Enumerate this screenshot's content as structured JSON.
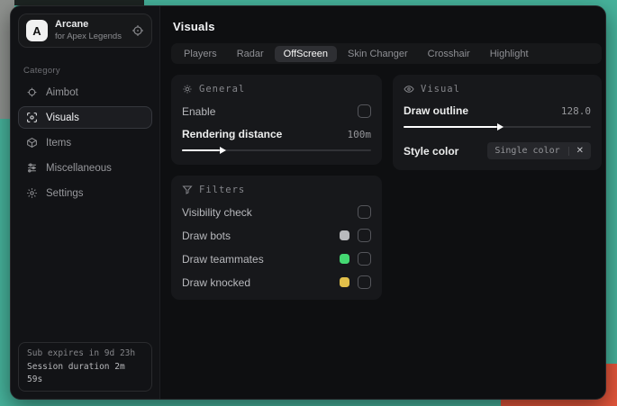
{
  "colors": {
    "backdrop_teal": "#46b29b",
    "backdrop_grey": "#8e918e",
    "backdrop_orange": "#e4563b",
    "swatch_bots": "#b9babd",
    "swatch_teammates": "#44d872",
    "swatch_knocked": "#e2bf4a"
  },
  "sidebar": {
    "app_name": "Arcane",
    "app_subtitle": "for Apex Legends",
    "logo_letter": "A",
    "category_label": "Category",
    "items": [
      {
        "label": "Aimbot"
      },
      {
        "label": "Visuals"
      },
      {
        "label": "Items"
      },
      {
        "label": "Miscellaneous"
      },
      {
        "label": "Settings"
      }
    ],
    "footer_line1": "Sub expires in 9d 23h",
    "footer_line2": "Session duration 2m 59s"
  },
  "main": {
    "title": "Visuals",
    "tabs": [
      {
        "label": "Players"
      },
      {
        "label": "Radar"
      },
      {
        "label": "OffScreen"
      },
      {
        "label": "Skin Changer"
      },
      {
        "label": "Crosshair"
      },
      {
        "label": "Highlight"
      }
    ],
    "active_tab": "OffScreen",
    "general": {
      "title": "General",
      "enable_label": "Enable",
      "distance_label": "Rendering distance",
      "distance_value": "100m",
      "distance_percent": 20
    },
    "visual": {
      "title": "Visual",
      "outline_label": "Draw outline",
      "outline_value": "128.0",
      "outline_percent": 50,
      "style_label": "Style color",
      "style_value": "Single color",
      "style_clear_icon": "✕"
    },
    "filters": {
      "title": "Filters",
      "rows": [
        {
          "label": "Visibility check",
          "swatch": null
        },
        {
          "label": "Draw bots",
          "swatch": "#b9babd"
        },
        {
          "label": "Draw teammates",
          "swatch": "#44d872"
        },
        {
          "label": "Draw knocked",
          "swatch": "#e2bf4a"
        }
      ]
    }
  }
}
